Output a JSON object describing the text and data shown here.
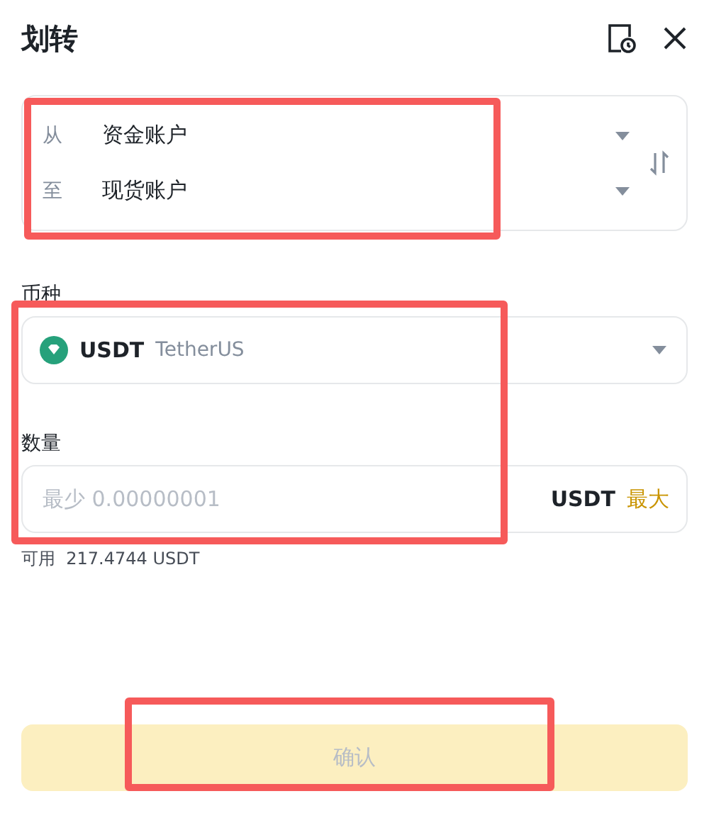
{
  "dialog": {
    "title": "划转"
  },
  "accounts": [
    {
      "label": "从",
      "value": "资金账户"
    },
    {
      "label": "至",
      "value": "现货账户"
    }
  ],
  "coin": {
    "label": "币种",
    "symbol": "USDT",
    "name": "TetherUS"
  },
  "amount": {
    "label": "数量",
    "placeholder": "最少 0.00000001",
    "unit": "USDT",
    "max": "最大"
  },
  "available": {
    "label": "可用",
    "value": "217.4744 USDT"
  },
  "confirm": {
    "label": "确认",
    "disabled": true
  },
  "annotations": [
    {
      "kind": "highlight"
    },
    {
      "kind": "highlight"
    },
    {
      "kind": "highlight"
    }
  ]
}
